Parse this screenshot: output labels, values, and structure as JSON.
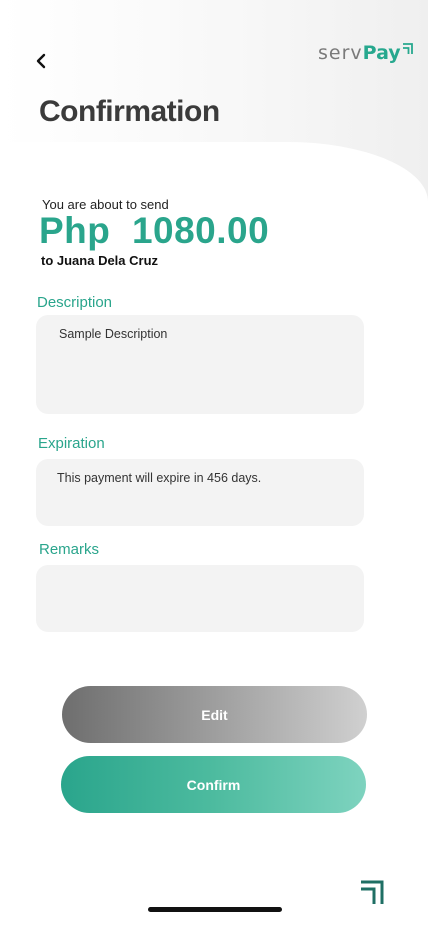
{
  "header": {
    "title": "Confirmation",
    "brand_prefix": "serv",
    "brand_suffix": "Pay"
  },
  "summary": {
    "lead_text": "You are about to send",
    "amount": "Php  1080.00",
    "recipient": "to Juana Dela Cruz"
  },
  "form": {
    "description_label": "Description",
    "description_value": "Sample Description",
    "expiration_label": "Expiration",
    "expiration_value": "This payment will expire in 456 days.",
    "remarks_label": "Remarks",
    "remarks_value": ""
  },
  "actions": {
    "edit_label": "Edit",
    "confirm_label": "Confirm"
  },
  "colors": {
    "accent": "#2aa58c",
    "title": "#3b3b3b",
    "field_bg": "#f3f3f3"
  },
  "icons": {
    "back": "chevron-left-icon",
    "brand_mark": "servpay-logo-mark-icon"
  }
}
